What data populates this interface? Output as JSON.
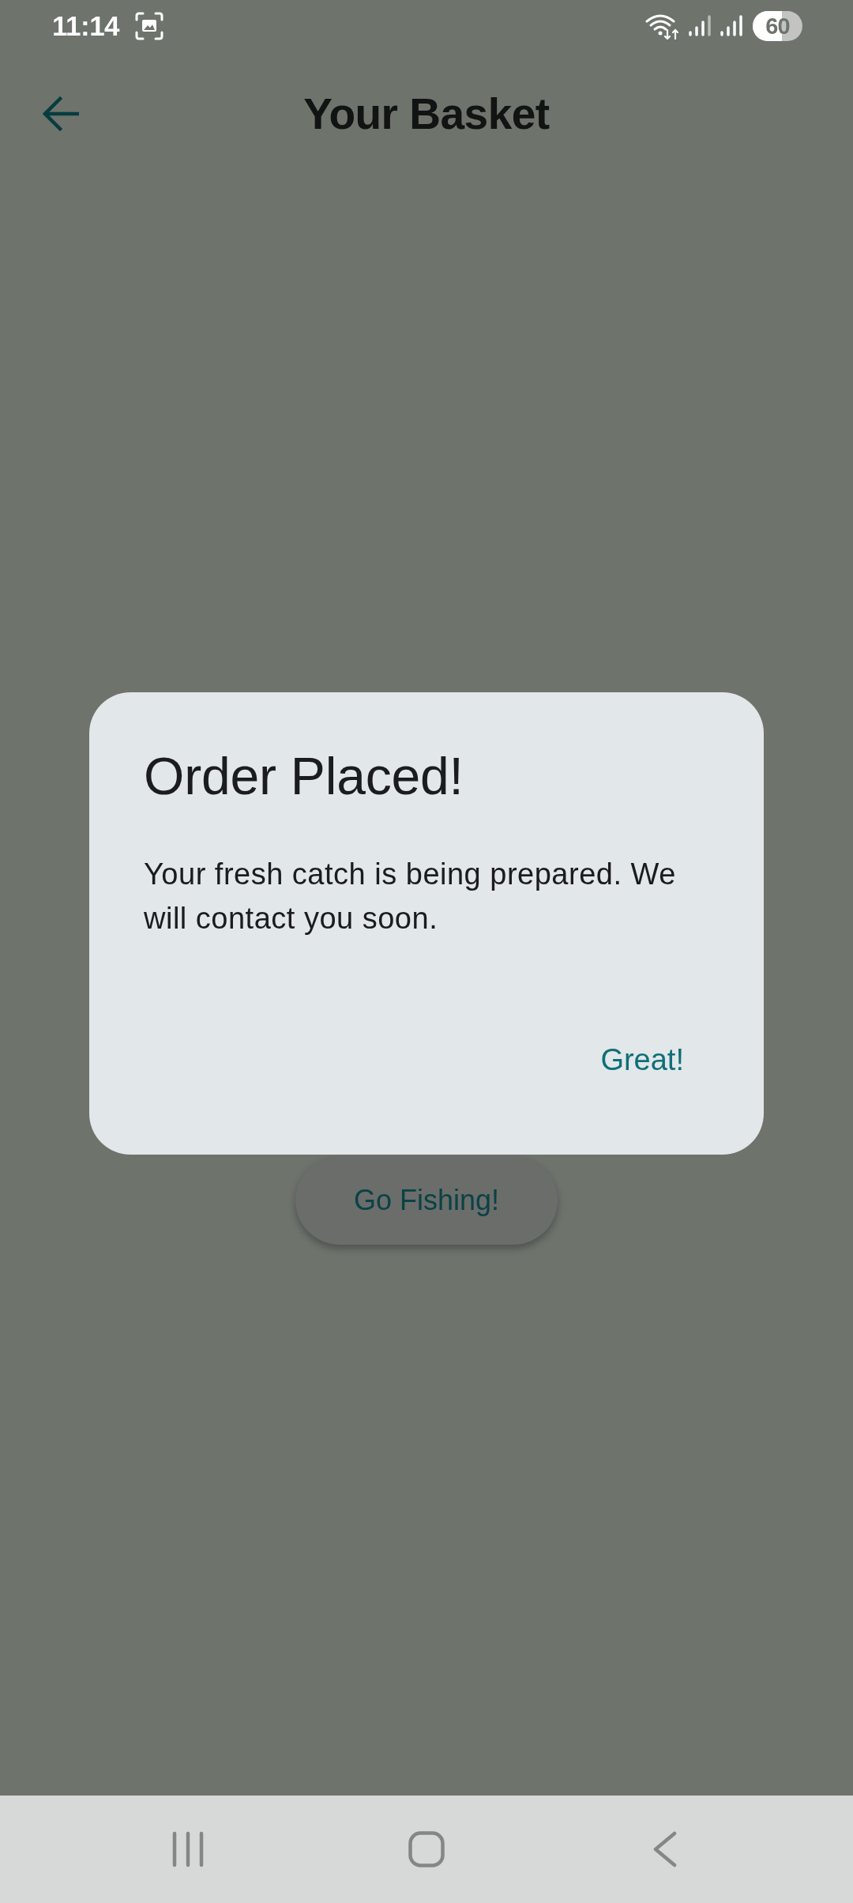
{
  "status_bar": {
    "time": "11:14",
    "battery": "60"
  },
  "header": {
    "title": "Your Basket"
  },
  "content": {
    "button": "Go Fishing!"
  },
  "dialog": {
    "title": "Order Placed!",
    "message": "Your fresh catch is being prepared. We will contact you soon.",
    "action": "Great!"
  }
}
